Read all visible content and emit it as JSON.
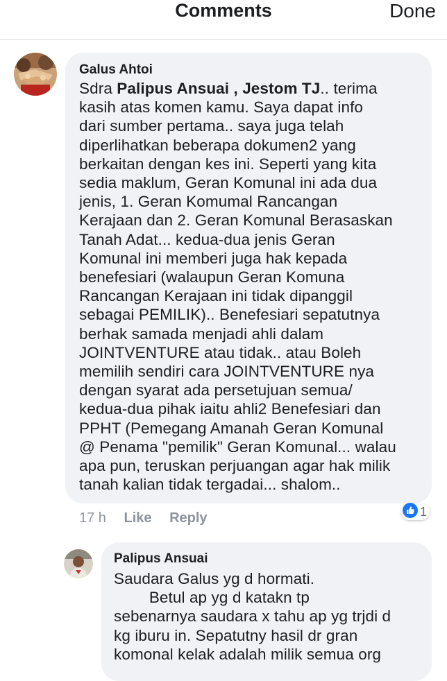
{
  "header": {
    "title": "Comments",
    "done_label": "Done"
  },
  "comments": [
    {
      "author": "Galus Ahtoi",
      "text_prefix": "Sdra ",
      "mention": "Palipus Ansuai , Jestom TJ",
      "text_line1_suffix": ".. terima",
      "text_rest": "kasih atas komen kamu. Saya dapat info\ndari sumber pertama.. saya juga telah\ndiperlihatkan beberapa dokumen2 yang\nberkaitan dengan kes ini. Seperti yang kita\nsedia maklum, Geran Komunal ini ada dua\njenis, 1. Geran Komumal Rancangan\nKerajaan dan 2. Geran Komunal Berasaskan\nTanah Adat... kedua-dua jenis Geran\nKomunal ini memberi juga hak kepada\nbenefesiari (walaupun Geran Komuna\nRancangan Kerajaan ini tidak dipanggil\nsebagai PEMILIK).. Benefesiari sepatutnya\nberhak samada menjadi ahli dalam\nJOINTVENTURE atau tidak.. atau Boleh\nmemilih sendiri cara JOINTVENTURE nya\ndengan syarat ada persetujuan semua/\nkedua-dua pihak iaitu ahli2 Benefesiari dan\nPPHT (Pemegang Amanah Geran Komunal\n@ Penama \"pemilik\" Geran Komunal... walau\napa pun, teruskan perjuangan agar hak milik\ntanah kalian tidak tergadai... shalom..",
      "time": "17 h",
      "like_label": "Like",
      "reply_label": "Reply",
      "reaction": "like",
      "reaction_count": "1"
    },
    {
      "author": "Palipus Ansuai",
      "text": "Saudara Galus yg d hormati.\n        Betul ap yg d katakn tp\nsebenarnya saudara x tahu ap yg trjdi d\nkg iburu in. Sepatutny hasil dr gran\nkomonal kelak adalah milik semua org"
    }
  ],
  "colors": {
    "bubble": "#f0f2f5",
    "meta": "#8d949e",
    "like_blue": "#1877f2"
  }
}
